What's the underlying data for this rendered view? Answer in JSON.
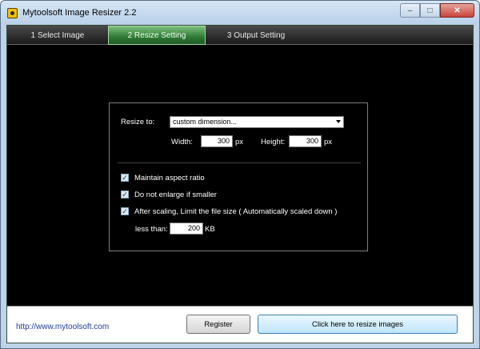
{
  "window": {
    "title": "Mytoolsoft Image Resizer 2.2",
    "controls": {
      "minimize": "–",
      "maximize": "□",
      "close": "✕"
    }
  },
  "tabs": [
    {
      "label": "1 Select Image",
      "active": false
    },
    {
      "label": "2 Resize Setting",
      "active": true
    },
    {
      "label": "3 Output Setting",
      "active": false
    }
  ],
  "resize": {
    "resize_to_label": "Resize to:",
    "resize_to_value": "custom dimension...",
    "width_label": "Width:",
    "width_value": "300",
    "width_unit": "px",
    "height_label": "Height:",
    "height_value": "300",
    "height_unit": "px"
  },
  "options": {
    "check_mark": "✓",
    "maintain_aspect": {
      "label": "Maintain aspect ratio",
      "checked": true
    },
    "no_enlarge": {
      "label": "Do not enlarge if smaller",
      "checked": true
    },
    "limit_size": {
      "label": "After scaling, Limit the file size ( Automatically scaled down )",
      "checked": true
    },
    "less_than_label": "less than:",
    "less_than_value": "200",
    "less_than_unit": "KB"
  },
  "footer": {
    "website": "http://www.mytoolsoft.com",
    "register_label": "Register",
    "resize_label": "Click here to resize images"
  },
  "colors": {
    "title_bar": "#bcd3ea",
    "active_tab": "#2f7a35",
    "link": "#1e3c9a"
  }
}
